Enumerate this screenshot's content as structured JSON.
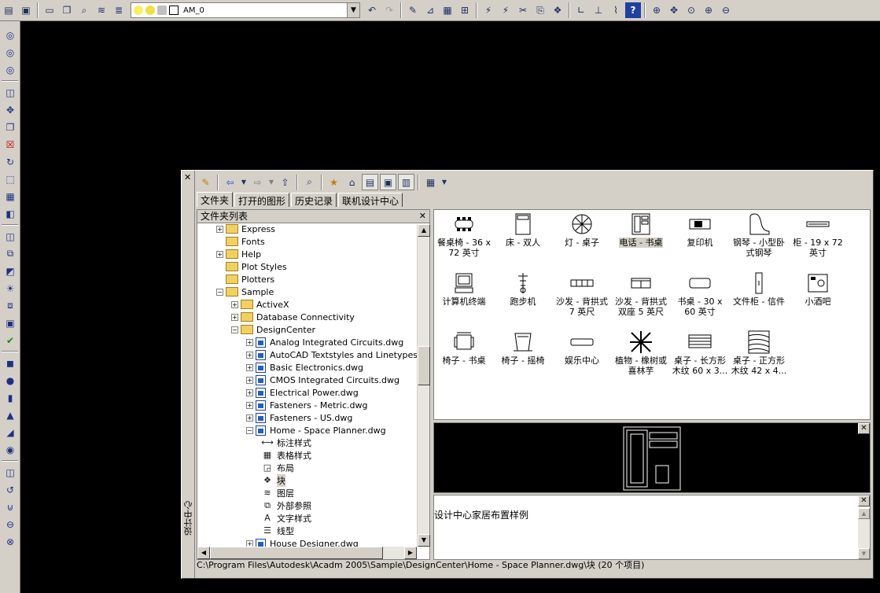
{
  "toolbar": {
    "layer_name": "AM_0",
    "layer_icons": [
      "lightbulb-icon",
      "sun-icon",
      "lock-icon",
      "color-swatch-icon"
    ]
  },
  "designcenter": {
    "title_vertical": "设计中心",
    "tabs": [
      {
        "label": "文件夹",
        "active": true
      },
      {
        "label": "打开的图形",
        "active": false
      },
      {
        "label": "历史记录",
        "active": false
      },
      {
        "label": "联机设计中心",
        "active": false
      }
    ],
    "tree_header": "文件夹列表",
    "tree": [
      {
        "label": "Express",
        "level": 0,
        "expander": "+",
        "type": "folder"
      },
      {
        "label": "Fonts",
        "level": 0,
        "expander": "",
        "type": "folder"
      },
      {
        "label": "Help",
        "level": 0,
        "expander": "+",
        "type": "folder"
      },
      {
        "label": "Plot Styles",
        "level": 0,
        "expander": "",
        "type": "folder"
      },
      {
        "label": "Plotters",
        "level": 0,
        "expander": "",
        "type": "folder"
      },
      {
        "label": "Sample",
        "level": 0,
        "expander": "−",
        "type": "folder"
      },
      {
        "label": "ActiveX",
        "level": 1,
        "expander": "+",
        "type": "folder"
      },
      {
        "label": "Database Connectivity",
        "level": 1,
        "expander": "+",
        "type": "folder"
      },
      {
        "label": "DesignCenter",
        "level": 1,
        "expander": "−",
        "type": "folder"
      },
      {
        "label": "Analog Integrated Circuits.dwg",
        "level": 2,
        "expander": "+",
        "type": "dwg"
      },
      {
        "label": "AutoCAD Textstyles and Linetypes.dwg",
        "level": 2,
        "expander": "+",
        "type": "dwg"
      },
      {
        "label": "Basic Electronics.dwg",
        "level": 2,
        "expander": "+",
        "type": "dwg"
      },
      {
        "label": "CMOS Integrated Circuits.dwg",
        "level": 2,
        "expander": "+",
        "type": "dwg"
      },
      {
        "label": "Electrical Power.dwg",
        "level": 2,
        "expander": "+",
        "type": "dwg"
      },
      {
        "label": "Fasteners - Metric.dwg",
        "level": 2,
        "expander": "+",
        "type": "dwg"
      },
      {
        "label": "Fasteners - US.dwg",
        "level": 2,
        "expander": "+",
        "type": "dwg"
      },
      {
        "label": "Home - Space Planner.dwg",
        "level": 2,
        "expander": "−",
        "type": "dwg"
      },
      {
        "label": "标注样式",
        "level": 3,
        "expander": "",
        "type": "sub",
        "icon": "dimstyle-icon"
      },
      {
        "label": "表格样式",
        "level": 3,
        "expander": "",
        "type": "sub",
        "icon": "tablestyle-icon"
      },
      {
        "label": "布局",
        "level": 3,
        "expander": "",
        "type": "sub",
        "icon": "layout-icon"
      },
      {
        "label": "块",
        "level": 3,
        "expander": "",
        "type": "sub",
        "icon": "block-icon",
        "selected": true
      },
      {
        "label": "图层",
        "level": 3,
        "expander": "",
        "type": "sub",
        "icon": "layer-icon"
      },
      {
        "label": "外部参照",
        "level": 3,
        "expander": "",
        "type": "sub",
        "icon": "xref-icon"
      },
      {
        "label": "文字样式",
        "level": 3,
        "expander": "",
        "type": "sub",
        "icon": "textstyle-icon"
      },
      {
        "label": "线型",
        "level": 3,
        "expander": "",
        "type": "sub",
        "icon": "linetype-icon"
      },
      {
        "label": "House Designer.dwg",
        "level": 2,
        "expander": "+",
        "type": "dwg"
      }
    ],
    "blocks": [
      {
        "label": "餐桌椅 - 36 x 72 英寸",
        "icon": "dining-table-icon"
      },
      {
        "label": "床 - 双人",
        "icon": "bed-icon"
      },
      {
        "label": "灯 - 桌子",
        "icon": "table-lamp-icon"
      },
      {
        "label": "电话 - 书桌",
        "icon": "phone-desk-icon",
        "selected": true
      },
      {
        "label": "复印机",
        "icon": "copier-icon"
      },
      {
        "label": "钢琴 - 小型卧式钢琴",
        "icon": "piano-icon"
      },
      {
        "label": "柜 - 19 x 72 英寸",
        "icon": "cabinet-icon"
      },
      {
        "label": "计算机终端",
        "icon": "computer-icon"
      },
      {
        "label": "跑步机",
        "icon": "treadmill-icon"
      },
      {
        "label": "沙发 - 背拱式 7 英尺",
        "icon": "sofa-icon"
      },
      {
        "label": "沙发 - 背拱式双座 5 英尺",
        "icon": "loveseat-icon"
      },
      {
        "label": "书桌 - 30 x 60 英寸",
        "icon": "desk-icon"
      },
      {
        "label": "文件柜 - 信件",
        "icon": "file-cabinet-icon"
      },
      {
        "label": "小酒吧",
        "icon": "bar-icon"
      },
      {
        "label": "椅子 - 书桌",
        "icon": "desk-chair-icon"
      },
      {
        "label": "椅子 - 摇椅",
        "icon": "rocking-chair-icon"
      },
      {
        "label": "娱乐中心",
        "icon": "entertainment-icon"
      },
      {
        "label": "植物 - 橡树或喜林芋",
        "icon": "plant-icon"
      },
      {
        "label": "桌子 - 长方形木纹 60 x 3...",
        "icon": "rect-table-icon"
      },
      {
        "label": "桌子 - 正方形木纹 42 x 4...",
        "icon": "square-table-icon"
      }
    ],
    "description": "设计中心家居布置样例",
    "status": "C:\\Program Files\\Autodesk\\Acadm 2005\\Sample\\DesignCenter\\Home - Space Planner.dwg\\块 (20 个项目)"
  }
}
